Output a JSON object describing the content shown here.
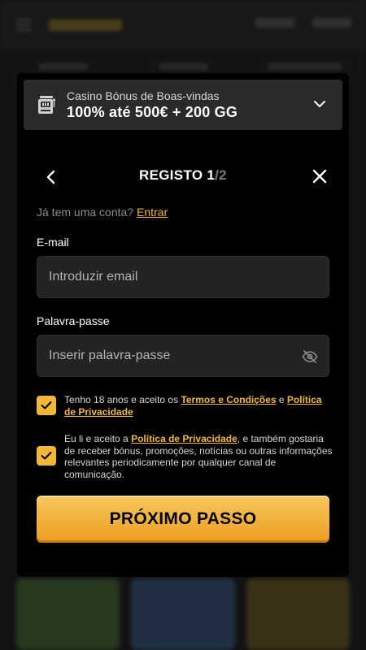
{
  "bonus": {
    "subtitle": "Casino Bónus de Boas-vindas",
    "title": "100% até 500€ + 200 GG"
  },
  "registration": {
    "title": "REGISTO 1",
    "step_separator": "/",
    "step_total": "2"
  },
  "account": {
    "prompt": "Já tem uma conta?",
    "login_link": "Entrar"
  },
  "email": {
    "label": "E-mail",
    "placeholder": "Introduzir email"
  },
  "password": {
    "label": "Palavra-passe",
    "placeholder": "Inserir palavra-passe"
  },
  "terms": {
    "age_prefix": "Tenho 18 anos e aceito os ",
    "terms_link": "Termos e Condições",
    "and": " e ",
    "privacy_link": "Política de Privacidade",
    "checked": true
  },
  "marketing": {
    "prefix": "Eu li e aceito a ",
    "privacy_link": "Política de Privacidade",
    "suffix": ", e também gostaria de receber bónus, promoções, notícias ou outras informações relevantes periodicamente por qualquer canal de comunicação.",
    "checked": true
  },
  "next_button": "PRÓXIMO PASSO",
  "colors": {
    "accent": "#f2b737",
    "button_top": "#f7c85c",
    "button_bottom": "#ec9d21",
    "modal_bg": "#000000",
    "input_bg": "#232323"
  },
  "icons": {
    "bonus": "slot-machine-icon",
    "expand": "chevron-down-icon",
    "back": "chevron-left-icon",
    "close": "close-icon",
    "password_visibility": "eye-off-icon",
    "checkbox": "check-icon"
  }
}
